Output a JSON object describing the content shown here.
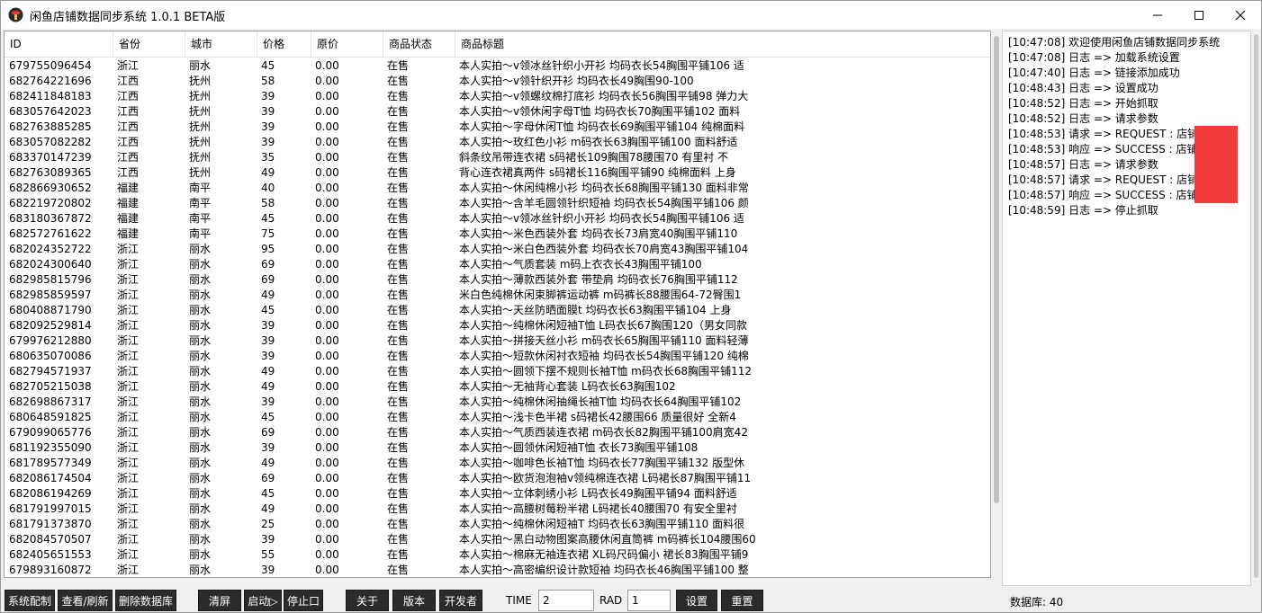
{
  "window": {
    "title": "闲鱼店铺数据同步系统 1.0.1 BETA版",
    "minimize_icon": "minimize-icon",
    "maximize_icon": "maximize-icon",
    "close_icon": "close-icon"
  },
  "table": {
    "columns": [
      "ID",
      "省份",
      "城市",
      "价格",
      "原价",
      "商品状态",
      "商品标题"
    ],
    "rows": [
      [
        "679755096454",
        "浙江",
        "丽水",
        "45",
        "0.00",
        "在售",
        "本人实拍～v领冰丝针织小开衫 均码衣长54胸围平铺106 适"
      ],
      [
        "682764221696",
        "江西",
        "抚州",
        "58",
        "0.00",
        "在售",
        "本人实拍～v领针织开衫 均码衣长49胸围90-100"
      ],
      [
        "682411848183",
        "江西",
        "抚州",
        "39",
        "0.00",
        "在售",
        "本人实拍～v领螺纹棉打底衫 均码衣长56胸围平铺98 弹力大"
      ],
      [
        "683057642023",
        "江西",
        "抚州",
        "39",
        "0.00",
        "在售",
        "本人实拍～v领休闲字母T恤 均码衣长70胸围平铺102 面料"
      ],
      [
        "682763885285",
        "江西",
        "抚州",
        "39",
        "0.00",
        "在售",
        "本人实拍～字母休闲T恤 均码衣长69胸围平铺104 纯棉面料"
      ],
      [
        "683057082282",
        "江西",
        "抚州",
        "39",
        "0.00",
        "在售",
        "本人实拍～玫红色小衫 m码衣长63胸围平铺100 面料舒适"
      ],
      [
        "683370147239",
        "江西",
        "抚州",
        "35",
        "0.00",
        "在售",
        "斜条纹吊带连衣裙 s码裙长109胸围78腰围70 有里衬 不"
      ],
      [
        "682763089365",
        "江西",
        "抚州",
        "49",
        "0.00",
        "在售",
        "背心连衣裙真两件 s码裙长116胸围平铺90 纯棉面料 上身"
      ],
      [
        "682866930652",
        "福建",
        "南平",
        "40",
        "0.00",
        "在售",
        "本人实拍～休闲纯棉小衫 均码衣长68胸围平铺130 面料非常"
      ],
      [
        "682219720802",
        "福建",
        "南平",
        "58",
        "0.00",
        "在售",
        "本人实拍～含羊毛圆领针织短袖 均码衣长54胸围平铺106 颜"
      ],
      [
        "683180367872",
        "福建",
        "南平",
        "45",
        "0.00",
        "在售",
        "本人实拍～v领冰丝针织小开衫 均码衣长54胸围平铺106 适"
      ],
      [
        "682572761622",
        "福建",
        "南平",
        "75",
        "0.00",
        "在售",
        "本人实拍～米色西装外套 均码衣长73肩宽40胸围平铺110"
      ],
      [
        "682024352722",
        "浙江",
        "丽水",
        "95",
        "0.00",
        "在售",
        "本人实拍～米白色西装外套 均码衣长70肩宽43胸围平铺104"
      ],
      [
        "682024300640",
        "浙江",
        "丽水",
        "69",
        "0.00",
        "在售",
        "本人实拍～气质套装 m码上衣衣长43胸围平铺100"
      ],
      [
        "682985815796",
        "浙江",
        "丽水",
        "69",
        "0.00",
        "在售",
        "本人实拍～薄款西装外套 带垫肩 均码衣长76胸围平铺112"
      ],
      [
        "682985859597",
        "浙江",
        "丽水",
        "49",
        "0.00",
        "在售",
        "米白色纯棉休闲束脚裤运动裤 m码裤长88腰围64-72臀围1"
      ],
      [
        "680408871790",
        "浙江",
        "丽水",
        "45",
        "0.00",
        "在售",
        "本人实拍～天丝防晒面膜t 均码衣长63胸围平铺104  上身"
      ],
      [
        "682092529814",
        "浙江",
        "丽水",
        "39",
        "0.00",
        "在售",
        "本人实拍～纯棉休闲短袖T恤 L码衣长67胸围120（男女同款"
      ],
      [
        "679976212880",
        "浙江",
        "丽水",
        "39",
        "0.00",
        "在售",
        "本人实拍～拼接天丝小衫 m码衣长65胸围平铺110 面料轻薄"
      ],
      [
        "680635070086",
        "浙江",
        "丽水",
        "39",
        "0.00",
        "在售",
        "本人实拍～短款休闲衬衣短袖 均码衣长54胸围平铺120 纯棉"
      ],
      [
        "682794571937",
        "浙江",
        "丽水",
        "49",
        "0.00",
        "在售",
        "本人实拍～圆领下摆不规则长袖T恤 m码衣长68胸围平铺112"
      ],
      [
        "682705215038",
        "浙江",
        "丽水",
        "49",
        "0.00",
        "在售",
        "本人实拍～无袖背心套装 L码衣长63胸围102"
      ],
      [
        "682698867317",
        "浙江",
        "丽水",
        "39",
        "0.00",
        "在售",
        "本人实拍～纯棉休闲抽绳长袖T恤 均码衣长64胸围平铺102"
      ],
      [
        "680648591825",
        "浙江",
        "丽水",
        "45",
        "0.00",
        "在售",
        "本人实拍～浅卡色半裙 s码裙长42腰围66 质量很好 全新4"
      ],
      [
        "679099065776",
        "浙江",
        "丽水",
        "69",
        "0.00",
        "在售",
        "本人实拍～气质西装连衣裙 m码衣长82胸围平铺100肩宽42"
      ],
      [
        "681192355090",
        "浙江",
        "丽水",
        "39",
        "0.00",
        "在售",
        "本人实拍～圆领休闲短袖T恤 衣长73胸围平铺108"
      ],
      [
        "681789577349",
        "浙江",
        "丽水",
        "49",
        "0.00",
        "在售",
        "本人实拍～咖啡色长袖T恤 均码衣长77胸围平铺132 版型休"
      ],
      [
        "682086174504",
        "浙江",
        "丽水",
        "69",
        "0.00",
        "在售",
        "本人实拍～欧货泡泡袖v领纯棉连衣裙 L码裙长87胸围平铺11"
      ],
      [
        "682086194269",
        "浙江",
        "丽水",
        "45",
        "0.00",
        "在售",
        "本人实拍～立体刺绣小衫 L码衣长49胸围平铺94 面料舒适"
      ],
      [
        "681791997015",
        "浙江",
        "丽水",
        "49",
        "0.00",
        "在售",
        "本人实拍～高腰树莓粉半裙 L码裙长40腰围70  有安全里衬"
      ],
      [
        "681791373870",
        "浙江",
        "丽水",
        "25",
        "0.00",
        "在售",
        "本人实拍～纯棉休闲短袖T 均码衣长63胸围平铺110 面料很"
      ],
      [
        "682084570507",
        "浙江",
        "丽水",
        "39",
        "0.00",
        "在售",
        "本人实拍～黑白动物图案高腰休闲直筒裤 m码裤长104腰围60"
      ],
      [
        "682405651553",
        "浙江",
        "丽水",
        "55",
        "0.00",
        "在售",
        "本人实拍～棉麻无袖连衣裙 XL码尺码偏小 裙长83胸围平铺9"
      ],
      [
        "679893160872",
        "浙江",
        "丽水",
        "39",
        "0.00",
        "在售",
        "本人实拍～高密编织设计款短袖 均码衣长46胸围平铺100 整"
      ]
    ]
  },
  "log": {
    "lines": [
      "[10:47:08]  欢迎使用闲鱼店铺数据同步系统",
      "[10:47:08]  日志 =>  加载系统设置",
      "[10:47:40]  日志 =>  链接添加成功",
      "[10:48:43]  日志 =>  设置成功",
      "[10:48:52]  日志 =>  开始抓取",
      "[10:48:52]  日志 =>  请求参数",
      "[10:48:53]  请求 =>  REQUEST : 店铺",
      "[10:48:53]  响应 =>  SUCCESS : 店铺",
      "[10:48:57]  日志 =>  请求参数",
      "[10:48:57]  请求 =>  REQUEST : 店铺",
      "[10:48:57]  响应 =>  SUCCESS : 店铺",
      "[10:48:59]  日志 =>  停止抓取"
    ],
    "redaction_color": "#f33b3b"
  },
  "toolbar": {
    "system_config": "系统配制",
    "view_refresh": "查看/刷新",
    "delete_db": "删除数据库",
    "clear_screen": "清屏",
    "start": "启动▷",
    "stop": "停止口",
    "about": "关于",
    "version": "版本",
    "developer": "开发者",
    "time_label": "TIME",
    "time_value": "2",
    "rad_label": "RAD",
    "rad_value": "1",
    "settings": "设置",
    "reset": "重置",
    "db_count": "数据库:  40"
  }
}
